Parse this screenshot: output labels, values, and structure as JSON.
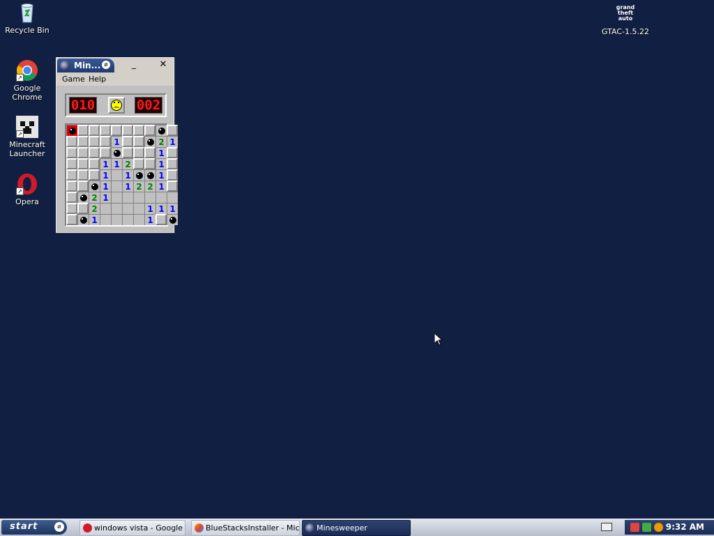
{
  "desktop": {
    "background": "#112042",
    "icons": {
      "recycle_bin": "Recycle Bin",
      "chrome": "Google Chrome",
      "minecraft": "Minecraft Launcher",
      "opera": "Opera",
      "gta": "GTAC-1.5.22",
      "gta_logo_text": "grand theft auto"
    }
  },
  "minesweeper": {
    "title": "Min...",
    "menu": {
      "game": "Game",
      "help": "Help"
    },
    "mine_counter": "010",
    "timer": "002",
    "face": "sad",
    "grid": [
      [
        "boom",
        "h",
        "h",
        "h",
        "h",
        "h",
        "h",
        "h",
        "m",
        "h"
      ],
      [
        "h",
        "h",
        "h",
        "h",
        "1",
        "h",
        "h",
        "m",
        "2",
        "1"
      ],
      [
        "h",
        "h",
        "h",
        "h",
        "m",
        "h",
        "h",
        "h",
        "1",
        "h"
      ],
      [
        "h",
        "h",
        "h",
        "1",
        "1",
        "2",
        "h",
        "h",
        "1",
        "h"
      ],
      [
        "h",
        "h",
        "h",
        "1",
        "e",
        "1",
        "m",
        "m",
        "1",
        "h"
      ],
      [
        "h",
        "h",
        "m",
        "1",
        "e",
        "1",
        "2",
        "2",
        "1",
        "h"
      ],
      [
        "h",
        "m",
        "2",
        "1",
        "e",
        "e",
        "e",
        "e",
        "e",
        "e"
      ],
      [
        "h",
        "h",
        "2",
        "e",
        "e",
        "e",
        "e",
        "1",
        "1",
        "1"
      ],
      [
        "h",
        "m",
        "1",
        "e",
        "e",
        "e",
        "e",
        "1",
        "h",
        "m"
      ]
    ]
  },
  "taskbar": {
    "start": "start",
    "items": [
      {
        "label": "windows vista - Google ...",
        "active": false
      },
      {
        "label": "BlueStacksInstaller - Mic...",
        "active": false
      },
      {
        "label": "Minesweeper",
        "active": true
      }
    ],
    "clock": "9:32 AM"
  },
  "colors": {
    "accent": "#1a2c55",
    "lcd_red": "#ff1a1a"
  }
}
